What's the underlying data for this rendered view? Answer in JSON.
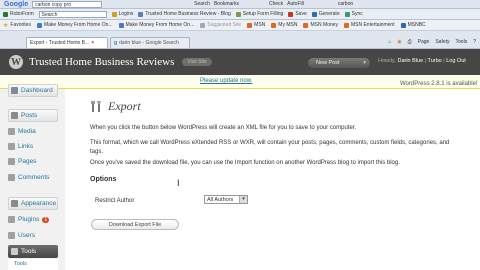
{
  "browser": {
    "google_label": "Google",
    "address": "carbon copy pro",
    "top_items": [
      "Search",
      "Bookmarks",
      "Check",
      "AutoFill",
      "carbon"
    ],
    "toolbar2": {
      "roboform": "RoboForm",
      "search_placeholder": "Search",
      "items": [
        "Logins",
        "Trusted Home Business Review - Blog",
        "Setup Form Filling",
        "Save",
        "Generate",
        "Sync"
      ]
    },
    "favorites": {
      "label": "Favorites",
      "items": [
        "Make Money From Home On...",
        "Make Money From Home On...",
        "Suggested Site",
        "MSN",
        "My MSN",
        "MSN Money",
        "MSN Entertainment",
        "MSNBC"
      ]
    },
    "tabs": [
      {
        "label": "Export ‹ Trusted Home B...",
        "active": true
      },
      {
        "label": "darin blue - Google Search",
        "active": false
      }
    ],
    "right_tools": [
      "Page",
      "Safety",
      "Tools"
    ]
  },
  "wp": {
    "site_title": "Trusted Home Business Reviews",
    "visit_site": "Visit Site",
    "new_post": "New Post",
    "howdy_prefix": "Howdy,",
    "user": "Darin Blue",
    "turbo": "Turbo",
    "logout": "Log Out",
    "nag_text": "WordPress 2.8.1 is available!",
    "nag_link": "Please update now.",
    "menu": {
      "dashboard": "Dashboard",
      "posts": "Posts",
      "media": "Media",
      "links": "Links",
      "pages": "Pages",
      "comments": "Comments",
      "appearance": "Appearance",
      "plugins": "Plugins",
      "plugins_badge": "1",
      "users": "Users",
      "tools": "Tools",
      "tools_sub": "Tools"
    },
    "page": {
      "title": "Export",
      "p1": "When you click the button below WordPress will create an XML file for you to save to your computer.",
      "p2": "This format, which we call WordPress eXtended RSS or WXR, will contain your posts, pages, comments, custom fields, categories, and tags.",
      "p3": "Once you've saved the download file, you can use the Import function on another WordPress blog to import this blog.",
      "options_heading": "Options",
      "restrict_author_label": "Restrict Author",
      "author_selected": "All Authors",
      "download_button": "Download Export File"
    }
  }
}
